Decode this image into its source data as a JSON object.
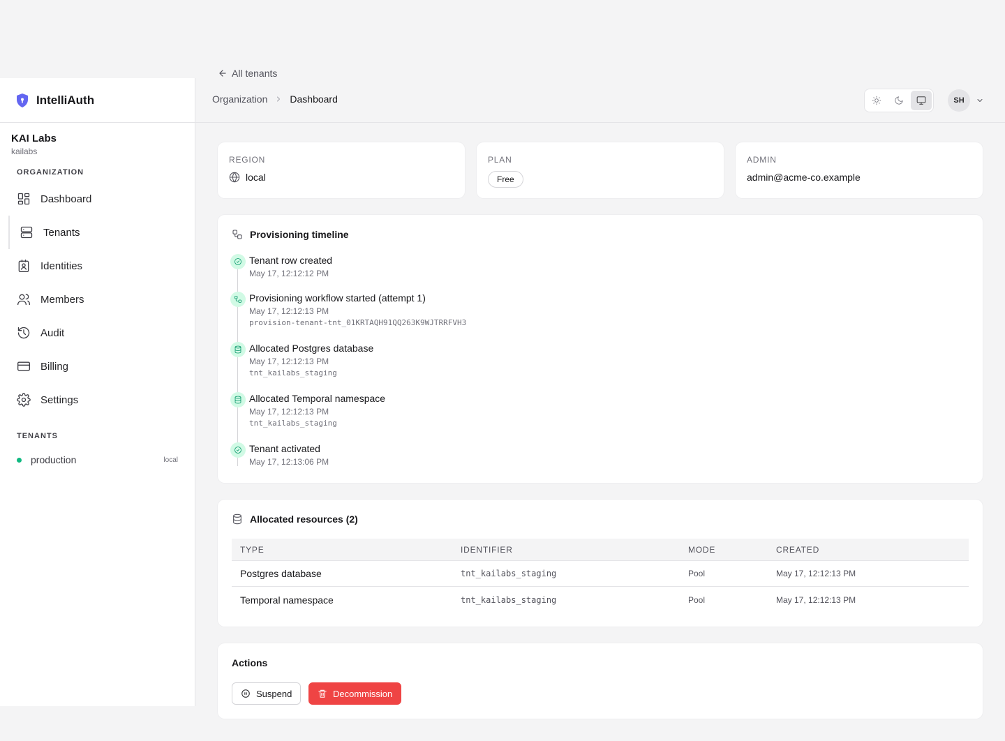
{
  "app": {
    "name": "IntelliAuth"
  },
  "organization": {
    "name": "KAI Labs",
    "slug": "kailabs",
    "section_label": "ORGANIZATION"
  },
  "sidebar": {
    "items": [
      {
        "label": "Dashboard",
        "icon": "dashboard-icon"
      },
      {
        "label": "Tenants",
        "icon": "server-icon"
      },
      {
        "label": "Identities",
        "icon": "id-badge-icon"
      },
      {
        "label": "Members",
        "icon": "users-icon"
      },
      {
        "label": "Audit",
        "icon": "history-icon"
      },
      {
        "label": "Billing",
        "icon": "credit-card-icon"
      },
      {
        "label": "Settings",
        "icon": "gear-icon"
      }
    ],
    "active": "Tenants",
    "tenants_label": "TENANTS",
    "tenants": [
      {
        "name": "production",
        "region": "local",
        "status_color": "#10b981"
      }
    ]
  },
  "header": {
    "back_label": "All tenants",
    "breadcrumb": [
      "Organization",
      "Dashboard"
    ],
    "theme_modes": [
      "light",
      "dark",
      "system"
    ],
    "theme_active": "system",
    "avatar_initials": "SH"
  },
  "summary": {
    "region_label": "REGION",
    "region_value": "local",
    "plan_label": "PLAN",
    "plan_value": "Free",
    "admin_label": "ADMIN",
    "admin_value": "admin@acme-co.example"
  },
  "timeline": {
    "title": "Provisioning timeline",
    "events": [
      {
        "title": "Tenant row created",
        "time": "May 17, 12:12:12 PM",
        "detail": "",
        "icon": "check-circle-icon"
      },
      {
        "title": "Provisioning workflow started (attempt 1)",
        "time": "May 17, 12:12:13 PM",
        "detail": "provision-tenant-tnt_01KRTAQH91QQ263K9WJTRRFVH3",
        "icon": "workflow-icon"
      },
      {
        "title": "Allocated Postgres database",
        "time": "May 17, 12:12:13 PM",
        "detail": "tnt_kailabs_staging",
        "icon": "database-icon"
      },
      {
        "title": "Allocated Temporal namespace",
        "time": "May 17, 12:12:13 PM",
        "detail": "tnt_kailabs_staging",
        "icon": "database-icon"
      },
      {
        "title": "Tenant activated",
        "time": "May 17, 12:13:06 PM",
        "detail": "",
        "icon": "check-circle-icon"
      }
    ]
  },
  "resources": {
    "title": "Allocated resources (2)",
    "columns": [
      "TYPE",
      "IDENTIFIER",
      "MODE",
      "CREATED"
    ],
    "rows": [
      {
        "type": "Postgres database",
        "identifier": "tnt_kailabs_staging",
        "mode": "Pool",
        "created": "May 17, 12:12:13 PM"
      },
      {
        "type": "Temporal namespace",
        "identifier": "tnt_kailabs_staging",
        "mode": "Pool",
        "created": "May 17, 12:12:13 PM"
      }
    ]
  },
  "actions": {
    "title": "Actions",
    "suspend_label": "Suspend",
    "decommission_label": "Decommission",
    "danger_color": "#ef4444"
  }
}
